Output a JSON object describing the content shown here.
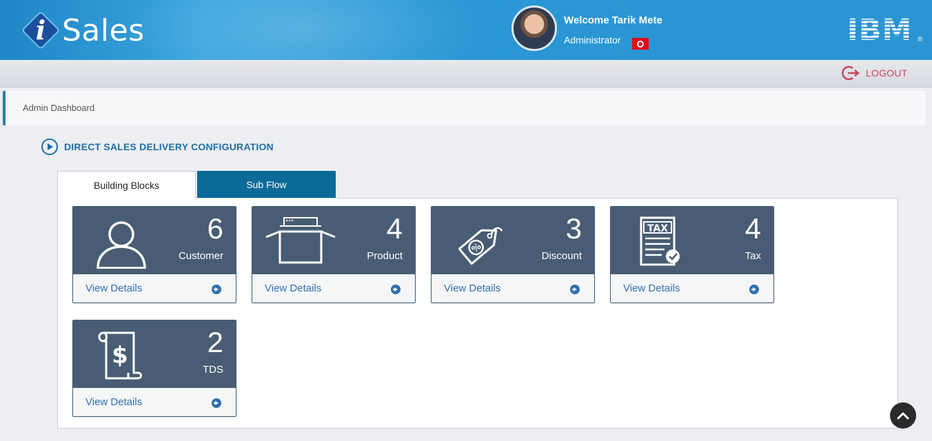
{
  "header": {
    "app_name": "Sales",
    "logo_letter": "i",
    "welcome": "Welcome Tarik Mete",
    "role": "Administrator",
    "brand": "IBM",
    "registered_mark": "®"
  },
  "topbar": {
    "logout_label": "LOGOUT"
  },
  "breadcrumb": {
    "current": "Admin Dashboard"
  },
  "section": {
    "title": "DIRECT SALES DELIVERY CONFIGURATION"
  },
  "tabs": [
    {
      "label": "Building Blocks",
      "active": true
    },
    {
      "label": "Sub Flow",
      "active": false
    }
  ],
  "cards": [
    {
      "count": "6",
      "label": "Customer",
      "link": "View Details",
      "icon": "user-icon"
    },
    {
      "count": "4",
      "label": "Product",
      "link": "View Details",
      "icon": "box-icon"
    },
    {
      "count": "3",
      "label": "Discount",
      "link": "View Details",
      "icon": "discount-tag-icon"
    },
    {
      "count": "4",
      "label": "Tax",
      "link": "View Details",
      "icon": "tax-document-icon"
    },
    {
      "count": "2",
      "label": "TDS",
      "link": "View Details",
      "icon": "dollar-scroll-icon"
    }
  ],
  "colors": {
    "header_blue": "#2a95d2",
    "card_top": "#485d73",
    "tab_active_bg": "#ffffff",
    "tab_inactive_bg": "#0b6a98",
    "link_blue": "#2f6fae",
    "logout_red": "#c9455a"
  }
}
